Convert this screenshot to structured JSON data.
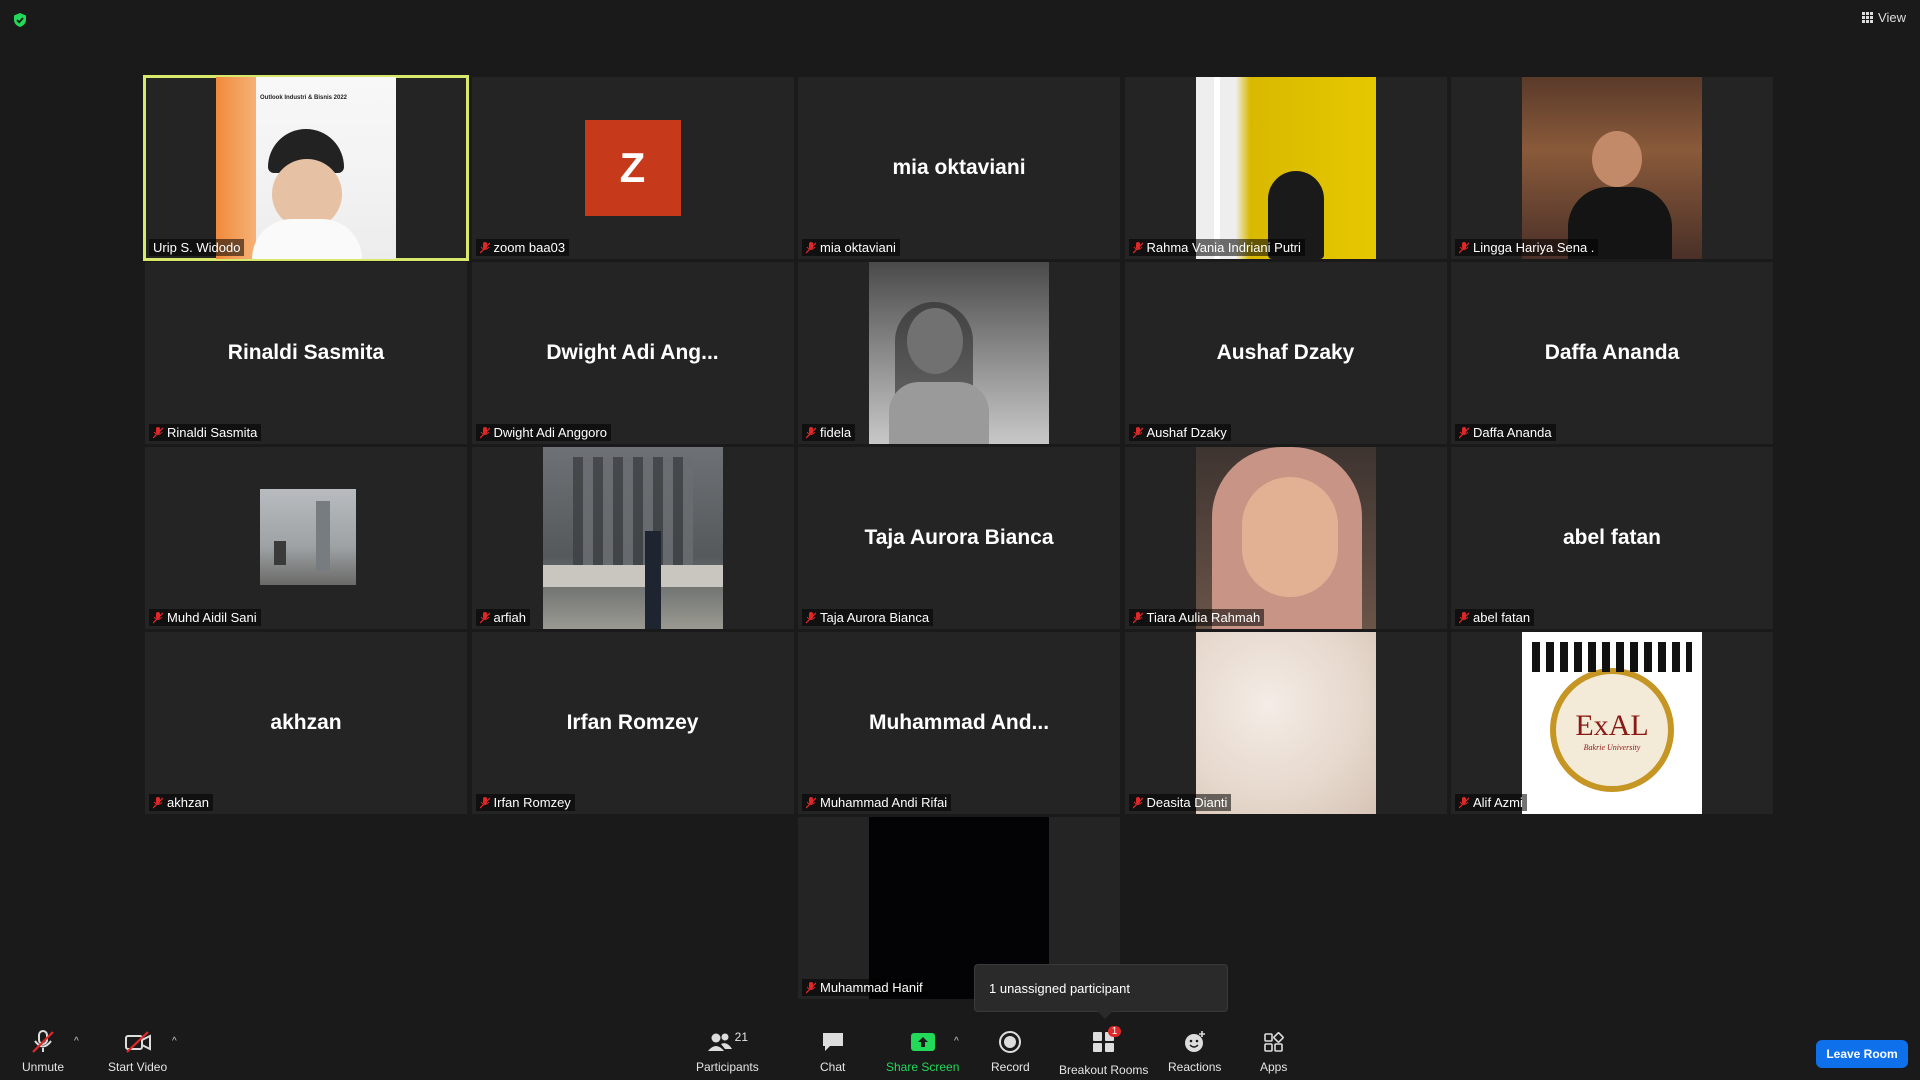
{
  "view_label": "View",
  "participants": [
    {
      "name": "Urip S. Widodo",
      "display": "video",
      "active": true
    },
    {
      "name": "zoom baa03",
      "display": "avatar",
      "avatar_letter": "Z"
    },
    {
      "name": "mia oktaviani",
      "display": "name",
      "center": "mia oktaviani"
    },
    {
      "name": "Rahma Vania Indriani Putri",
      "display": "video"
    },
    {
      "name": "Lingga Hariya Sena .",
      "display": "video"
    },
    {
      "name": "Rinaldi Sasmita",
      "display": "name",
      "center": "Rinaldi Sasmita"
    },
    {
      "name": "Dwight Adi Anggoro",
      "display": "name",
      "center": "Dwight  Adi  Ang..."
    },
    {
      "name": "fidela",
      "display": "video"
    },
    {
      "name": "Aushaf Dzaky",
      "display": "name",
      "center": "Aushaf Dzaky"
    },
    {
      "name": "Daffa Ananda",
      "display": "name",
      "center": "Daffa Ananda"
    },
    {
      "name": "Muhd Aidil Sani",
      "display": "video"
    },
    {
      "name": "arfiah",
      "display": "video"
    },
    {
      "name": "Taja Aurora Bianca",
      "display": "name",
      "center": "Taja Aurora Bianca"
    },
    {
      "name": "Tiara Aulia Rahmah",
      "display": "video"
    },
    {
      "name": "abel fatan",
      "display": "name",
      "center": "abel fatan"
    },
    {
      "name": "akhzan",
      "display": "name",
      "center": "akhzan"
    },
    {
      "name": "Irfan Romzey",
      "display": "name",
      "center": "Irfan Romzey"
    },
    {
      "name": "Muhammad Andi Rifai",
      "display": "name",
      "center": "Muhammad  And..."
    },
    {
      "name": "Deasita Dianti",
      "display": "video"
    },
    {
      "name": "Alif Azmi",
      "display": "video",
      "logo_text": "ExAL",
      "logo_subtext": "Bakrie University"
    },
    {
      "name": "",
      "display": "empty"
    },
    {
      "name": "",
      "display": "empty"
    },
    {
      "name": "Muhammad Hanif",
      "display": "video"
    }
  ],
  "urip_banner": "Outlook Industri & Bisnis 2022",
  "tooltip": "1 unassigned participant",
  "toolbar": {
    "unmute": "Unmute",
    "start_video": "Start Video",
    "participants": "Participants",
    "participants_count": "21",
    "chat": "Chat",
    "share_screen": "Share Screen",
    "record": "Record",
    "breakout_rooms": "Breakout Rooms",
    "breakout_badge": "1",
    "reactions": "Reactions",
    "apps": "Apps",
    "leave": "Leave Room"
  },
  "colors": {
    "accent": "#0e71eb",
    "active_speaker": "#d7e86b",
    "share_green": "#23d959",
    "muted_red": "#e02828"
  }
}
